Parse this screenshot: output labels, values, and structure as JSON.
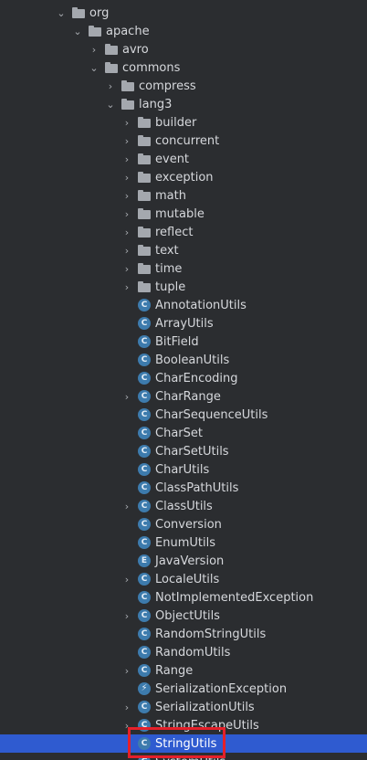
{
  "tree": {
    "items": [
      {
        "label": "org",
        "type": "folder",
        "depth": 0,
        "expander": "expanded",
        "icon": "folder-icon"
      },
      {
        "label": "apache",
        "type": "folder",
        "depth": 1,
        "expander": "expanded",
        "icon": "folder-icon"
      },
      {
        "label": "avro",
        "type": "folder",
        "depth": 2,
        "expander": "collapsed",
        "icon": "folder-icon"
      },
      {
        "label": "commons",
        "type": "folder",
        "depth": 2,
        "expander": "expanded",
        "icon": "folder-icon"
      },
      {
        "label": "compress",
        "type": "folder",
        "depth": 3,
        "expander": "collapsed",
        "icon": "folder-icon"
      },
      {
        "label": "lang3",
        "type": "folder",
        "depth": 3,
        "expander": "expanded",
        "icon": "folder-icon"
      },
      {
        "label": "builder",
        "type": "folder",
        "depth": 4,
        "expander": "collapsed",
        "icon": "folder-icon"
      },
      {
        "label": "concurrent",
        "type": "folder",
        "depth": 4,
        "expander": "collapsed",
        "icon": "folder-icon"
      },
      {
        "label": "event",
        "type": "folder",
        "depth": 4,
        "expander": "collapsed",
        "icon": "folder-icon"
      },
      {
        "label": "exception",
        "type": "folder",
        "depth": 4,
        "expander": "collapsed",
        "icon": "folder-icon"
      },
      {
        "label": "math",
        "type": "folder",
        "depth": 4,
        "expander": "collapsed",
        "icon": "folder-icon"
      },
      {
        "label": "mutable",
        "type": "folder",
        "depth": 4,
        "expander": "collapsed",
        "icon": "folder-icon"
      },
      {
        "label": "reflect",
        "type": "folder",
        "depth": 4,
        "expander": "collapsed",
        "icon": "folder-icon"
      },
      {
        "label": "text",
        "type": "folder",
        "depth": 4,
        "expander": "collapsed",
        "icon": "folder-icon"
      },
      {
        "label": "time",
        "type": "folder",
        "depth": 4,
        "expander": "collapsed",
        "icon": "folder-icon"
      },
      {
        "label": "tuple",
        "type": "folder",
        "depth": 4,
        "expander": "collapsed",
        "icon": "folder-icon"
      },
      {
        "label": "AnnotationUtils",
        "type": "class",
        "depth": 4,
        "expander": "none",
        "icon": "class-icon"
      },
      {
        "label": "ArrayUtils",
        "type": "class",
        "depth": 4,
        "expander": "none",
        "icon": "class-icon"
      },
      {
        "label": "BitField",
        "type": "class",
        "depth": 4,
        "expander": "none",
        "icon": "class-icon"
      },
      {
        "label": "BooleanUtils",
        "type": "class",
        "depth": 4,
        "expander": "none",
        "icon": "class-icon"
      },
      {
        "label": "CharEncoding",
        "type": "class",
        "depth": 4,
        "expander": "none",
        "icon": "class-icon"
      },
      {
        "label": "CharRange",
        "type": "class",
        "depth": 4,
        "expander": "collapsed",
        "icon": "class-icon"
      },
      {
        "label": "CharSequenceUtils",
        "type": "class",
        "depth": 4,
        "expander": "none",
        "icon": "class-icon"
      },
      {
        "label": "CharSet",
        "type": "class",
        "depth": 4,
        "expander": "none",
        "icon": "class-icon"
      },
      {
        "label": "CharSetUtils",
        "type": "class",
        "depth": 4,
        "expander": "none",
        "icon": "class-icon"
      },
      {
        "label": "CharUtils",
        "type": "class",
        "depth": 4,
        "expander": "none",
        "icon": "class-icon"
      },
      {
        "label": "ClassPathUtils",
        "type": "class",
        "depth": 4,
        "expander": "none",
        "icon": "class-icon"
      },
      {
        "label": "ClassUtils",
        "type": "class",
        "depth": 4,
        "expander": "collapsed",
        "icon": "class-icon"
      },
      {
        "label": "Conversion",
        "type": "class",
        "depth": 4,
        "expander": "none",
        "icon": "class-icon"
      },
      {
        "label": "EnumUtils",
        "type": "class",
        "depth": 4,
        "expander": "none",
        "icon": "class-icon"
      },
      {
        "label": "JavaVersion",
        "type": "enum",
        "depth": 4,
        "expander": "none",
        "icon": "enum-icon"
      },
      {
        "label": "LocaleUtils",
        "type": "class",
        "depth": 4,
        "expander": "collapsed",
        "icon": "class-icon"
      },
      {
        "label": "NotImplementedException",
        "type": "class",
        "depth": 4,
        "expander": "none",
        "icon": "class-icon"
      },
      {
        "label": "ObjectUtils",
        "type": "class",
        "depth": 4,
        "expander": "collapsed",
        "icon": "class-icon"
      },
      {
        "label": "RandomStringUtils",
        "type": "class",
        "depth": 4,
        "expander": "none",
        "icon": "class-icon"
      },
      {
        "label": "RandomUtils",
        "type": "class",
        "depth": 4,
        "expander": "none",
        "icon": "class-icon"
      },
      {
        "label": "Range",
        "type": "class",
        "depth": 4,
        "expander": "collapsed",
        "icon": "class-icon"
      },
      {
        "label": "SerializationException",
        "type": "exception",
        "depth": 4,
        "expander": "none",
        "icon": "exception-icon"
      },
      {
        "label": "SerializationUtils",
        "type": "class",
        "depth": 4,
        "expander": "collapsed",
        "icon": "class-icon"
      },
      {
        "label": "StringEscapeUtils",
        "type": "class",
        "depth": 4,
        "expander": "collapsed",
        "icon": "class-icon"
      },
      {
        "label": "StringUtils",
        "type": "class",
        "depth": 4,
        "expander": "none",
        "icon": "class-icon",
        "selected": true
      },
      {
        "label": "SystemUtils",
        "type": "class",
        "depth": 4,
        "expander": "none",
        "icon": "class-icon"
      }
    ]
  },
  "glyphs": {
    "class": "C",
    "enum": "E",
    "exception": "⚡",
    "expanded": "⌄",
    "collapsed": "›"
  },
  "colors": {
    "background": "#2b2d30",
    "selection": "#2f5bd0",
    "highlight_box": "#e5202a",
    "class_icon": "#3d7bad",
    "folder_icon": "#a4a8ae"
  }
}
